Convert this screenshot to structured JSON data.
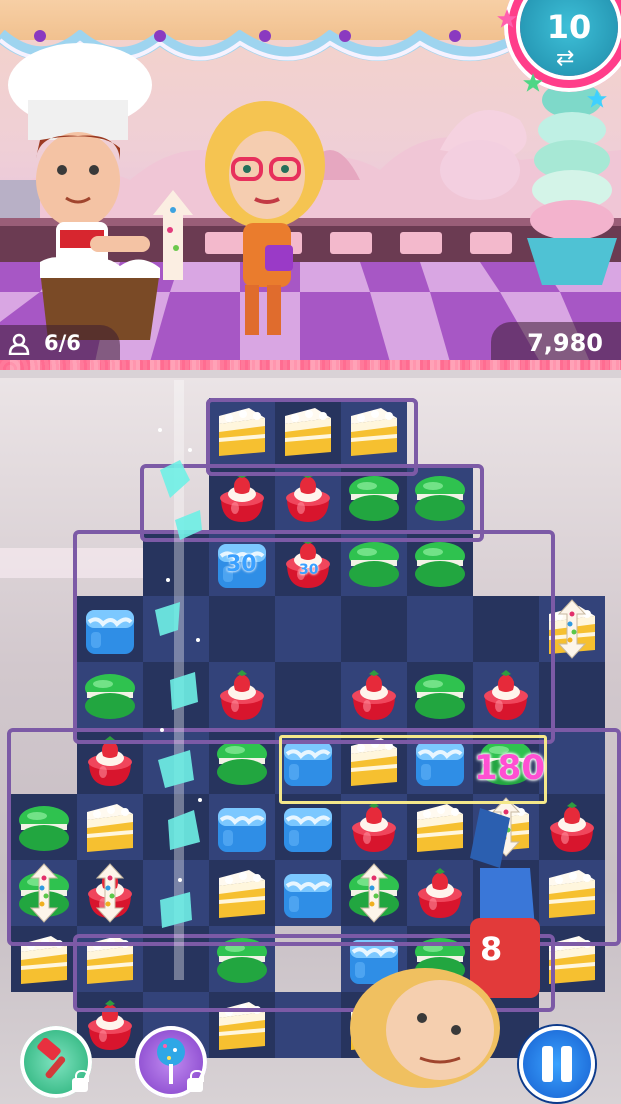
{
  "hud": {
    "moves_counter": "6/6",
    "score": "7,980",
    "moves_left": "10"
  },
  "popups": {
    "small_1": "30",
    "small_2": "30",
    "combo": "180"
  },
  "icons": {
    "person": "person-icon",
    "swap": "swap-arrows-icon",
    "booster_1": "hammer-icon",
    "booster_2": "cake-pop-icon",
    "pause": "pause-icon",
    "lock": "lock-icon"
  },
  "colors": {
    "board_dark": "#27345e",
    "board_light": "#33437a",
    "accent_pink": "#ff3e8a",
    "combo_text": "#ff4fd2",
    "pause_blue": "#1e6ee0"
  },
  "grid": {
    "rows": [
      [
        "",
        "",
        "",
        "cake",
        "cake",
        "cake",
        "",
        "",
        ""
      ],
      [
        "",
        "",
        "",
        "straw",
        "straw",
        "mac",
        "mac",
        "",
        ""
      ],
      [
        "",
        "",
        "",
        "blue",
        "straw",
        "mac",
        "mac",
        "",
        ""
      ],
      [
        "",
        "blue",
        "",
        "",
        "",
        "",
        "",
        "",
        "cakeS"
      ],
      [
        "",
        "mac",
        "",
        "straw",
        "",
        "straw",
        "mac",
        "straw",
        ""
      ],
      [
        "",
        "straw",
        "",
        "mac",
        "blue",
        "cake",
        "blue",
        "mac",
        ""
      ],
      [
        "mac",
        "cake",
        "",
        "blue",
        "blue",
        "straw",
        "cake",
        "cakeS",
        "straw"
      ],
      [
        "macS",
        "strawS",
        "",
        "cake",
        "blue",
        "macS",
        "straw",
        "",
        "cake"
      ],
      [
        "cake",
        "cake",
        "",
        "mac",
        "",
        "blue",
        "mac",
        "",
        "cake"
      ],
      [
        "",
        "straw",
        "",
        "cake",
        "",
        "cake",
        "",
        "",
        ""
      ]
    ]
  }
}
